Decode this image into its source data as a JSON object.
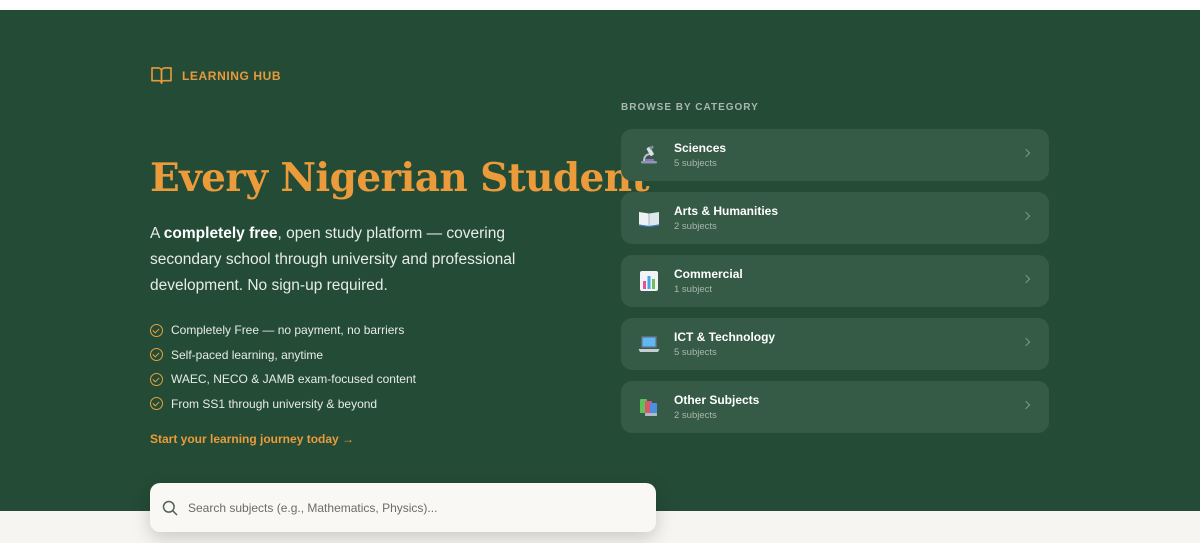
{
  "hub": {
    "label": "LEARNING HUB"
  },
  "hero": {
    "title": "Every Nigerian Student",
    "lead_prefix": "A ",
    "lead_bold": "completely free",
    "lead_rest": ", open study platform — covering secondary school through university and professional development. No sign-up required."
  },
  "features": [
    "Completely Free — no payment, no barriers",
    "Self-paced learning, anytime",
    "WAEC, NECO & JAMB exam-focused content",
    "From SS1 through university & beyond"
  ],
  "cta": {
    "label": "Start your learning journey today →"
  },
  "search": {
    "placeholder": "Search subjects (e.g., Mathematics, Physics)..."
  },
  "browse": {
    "heading": "BROWSE BY CATEGORY",
    "categories": [
      {
        "name": "Sciences",
        "count": "5 subjects",
        "icon": "microscope-icon"
      },
      {
        "name": "Arts & Humanities",
        "count": "2 subjects",
        "icon": "open-book-icon"
      },
      {
        "name": "Commercial",
        "count": "1 subject",
        "icon": "bar-chart-icon"
      },
      {
        "name": "ICT & Technology",
        "count": "5 subjects",
        "icon": "laptop-icon"
      },
      {
        "name": "Other Subjects",
        "count": "2 subjects",
        "icon": "books-icon"
      }
    ]
  },
  "colors": {
    "hero_bg": "#244b36",
    "accent": "#eb9b3a",
    "card_bg": "#355a45",
    "page_bg": "#f7f5f1"
  }
}
